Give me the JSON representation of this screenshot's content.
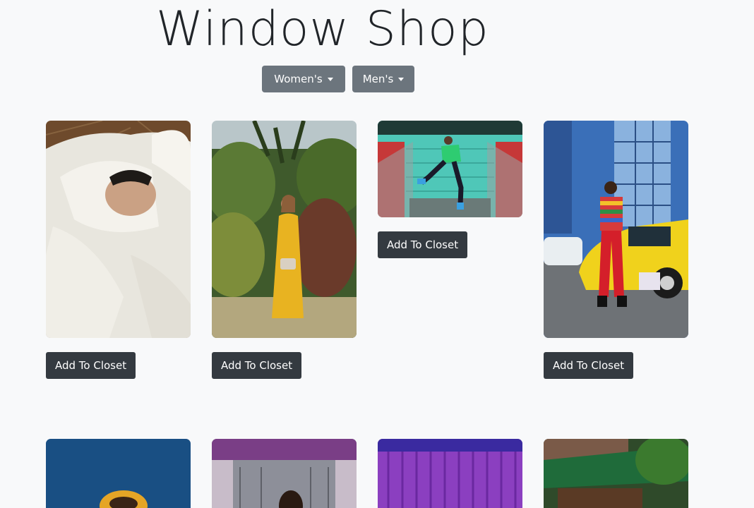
{
  "header": {
    "title": "Window Shop"
  },
  "filters": {
    "women_label": "Women's",
    "men_label": "Men's"
  },
  "products": {
    "add_label": "Add To Closet"
  },
  "colors": {
    "background": "#f8f9fa",
    "secondary_button": "#6c757d",
    "dark_button": "#343a40"
  }
}
